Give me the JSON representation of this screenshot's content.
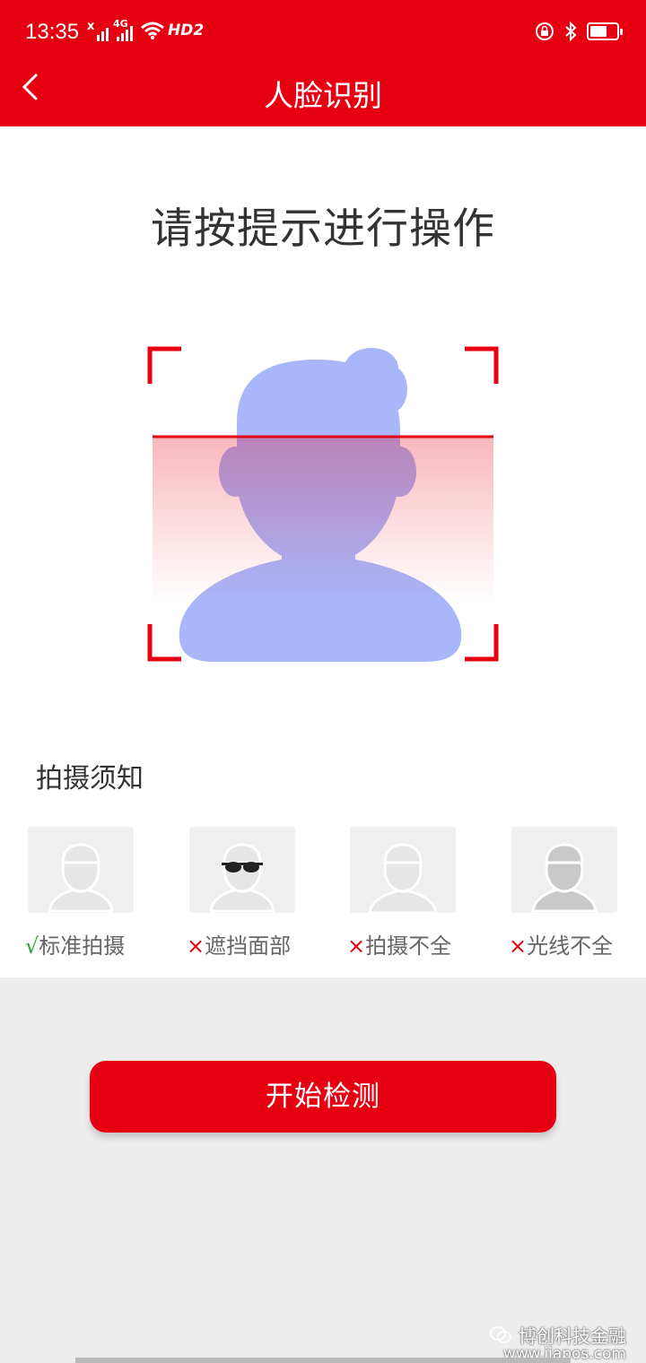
{
  "status_bar": {
    "time": "13:35",
    "sim1_label": "x",
    "sim2_label": "4G",
    "hd_label": "HD2",
    "icons": [
      "signal-x-icon",
      "signal-4g-icon",
      "wifi-icon",
      "hd-icon",
      "lock-rotation-icon",
      "bluetooth-icon",
      "battery-icon"
    ]
  },
  "header": {
    "title": "人脸识别",
    "back_icon": "chevron-left-icon"
  },
  "main": {
    "prompt": "请按提示进行操作",
    "notice_title": "拍摄须知",
    "tips": [
      {
        "mark": "√",
        "label": "标准拍摄",
        "status": "ok",
        "icon": "person-icon"
      },
      {
        "mark": "×",
        "label": "遮挡面部",
        "status": "bad",
        "icon": "person-sunglasses-icon"
      },
      {
        "mark": "×",
        "label": "拍摄不全",
        "status": "bad",
        "icon": "person-cropped-icon"
      },
      {
        "mark": "×",
        "label": "光线不全",
        "status": "bad",
        "icon": "person-dark-icon"
      }
    ]
  },
  "actions": {
    "start_label": "开始检测"
  },
  "watermark": {
    "name": "博创科技金融",
    "url": "www.iiapos.com"
  },
  "colors": {
    "brand_red": "#e60012",
    "avatar_blue": "#a9b6fa",
    "ok_green": "#2e9e34"
  }
}
